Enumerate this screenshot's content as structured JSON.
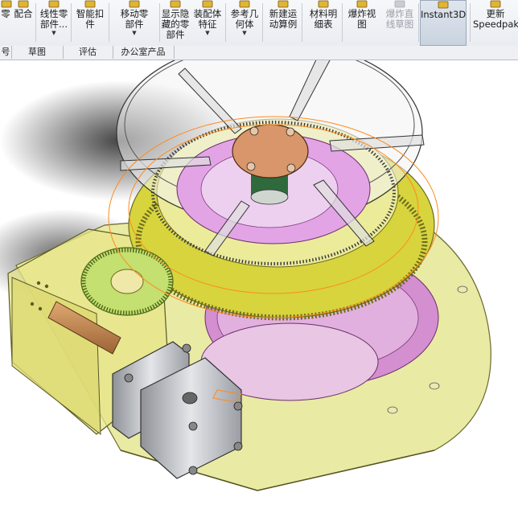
{
  "ribbon": {
    "buttons": [
      {
        "label": "零",
        "arrow": false,
        "dim": false,
        "icon": "cut-icon"
      },
      {
        "label": "配合",
        "arrow": false,
        "dim": false,
        "icon": "mate-icon"
      },
      {
        "label": "线性零\n部件...",
        "arrow": true,
        "dim": false,
        "icon": "linear-pattern-icon"
      },
      {
        "label": "智能扣\n件",
        "arrow": false,
        "dim": false,
        "icon": "smart-fastener-icon"
      },
      {
        "label": "移动零\n部件",
        "arrow": true,
        "dim": false,
        "icon": "move-component-icon"
      },
      {
        "label": "显示隐\n藏的零\n部件",
        "arrow": false,
        "dim": false,
        "icon": "show-hidden-icon"
      },
      {
        "label": "装配体\n特征",
        "arrow": true,
        "dim": false,
        "icon": "assembly-feature-icon"
      },
      {
        "label": "参考几\n何体",
        "arrow": true,
        "dim": false,
        "icon": "reference-geometry-icon"
      },
      {
        "label": "新建运\n动算例",
        "arrow": false,
        "dim": false,
        "icon": "motion-study-icon"
      },
      {
        "label": "材料明\n细表",
        "arrow": false,
        "dim": false,
        "icon": "bom-icon"
      },
      {
        "label": "爆炸视\n图",
        "arrow": false,
        "dim": false,
        "icon": "exploded-view-icon"
      },
      {
        "label": "爆炸直\n线草图",
        "arrow": false,
        "dim": true,
        "icon": "explode-line-icon"
      },
      {
        "label": "Instant3D",
        "arrow": false,
        "dim": false,
        "icon": "instant3d-icon"
      },
      {
        "label": "更新\nSpeedpak",
        "arrow": false,
        "dim": false,
        "icon": "speedpak-icon"
      }
    ]
  },
  "tabs": [
    "号",
    "草图",
    "评估",
    "办公室产品"
  ],
  "colors": {
    "accent": "#3a78c8",
    "plate": "#e6e79a",
    "gear_yellow": "#d8d63a",
    "gear_green": "#b8dc60",
    "magenta": "#d88ad8",
    "copper": "#d9966a",
    "motor": "#c9cbd0",
    "orange_curve": "#ff8a1a"
  }
}
